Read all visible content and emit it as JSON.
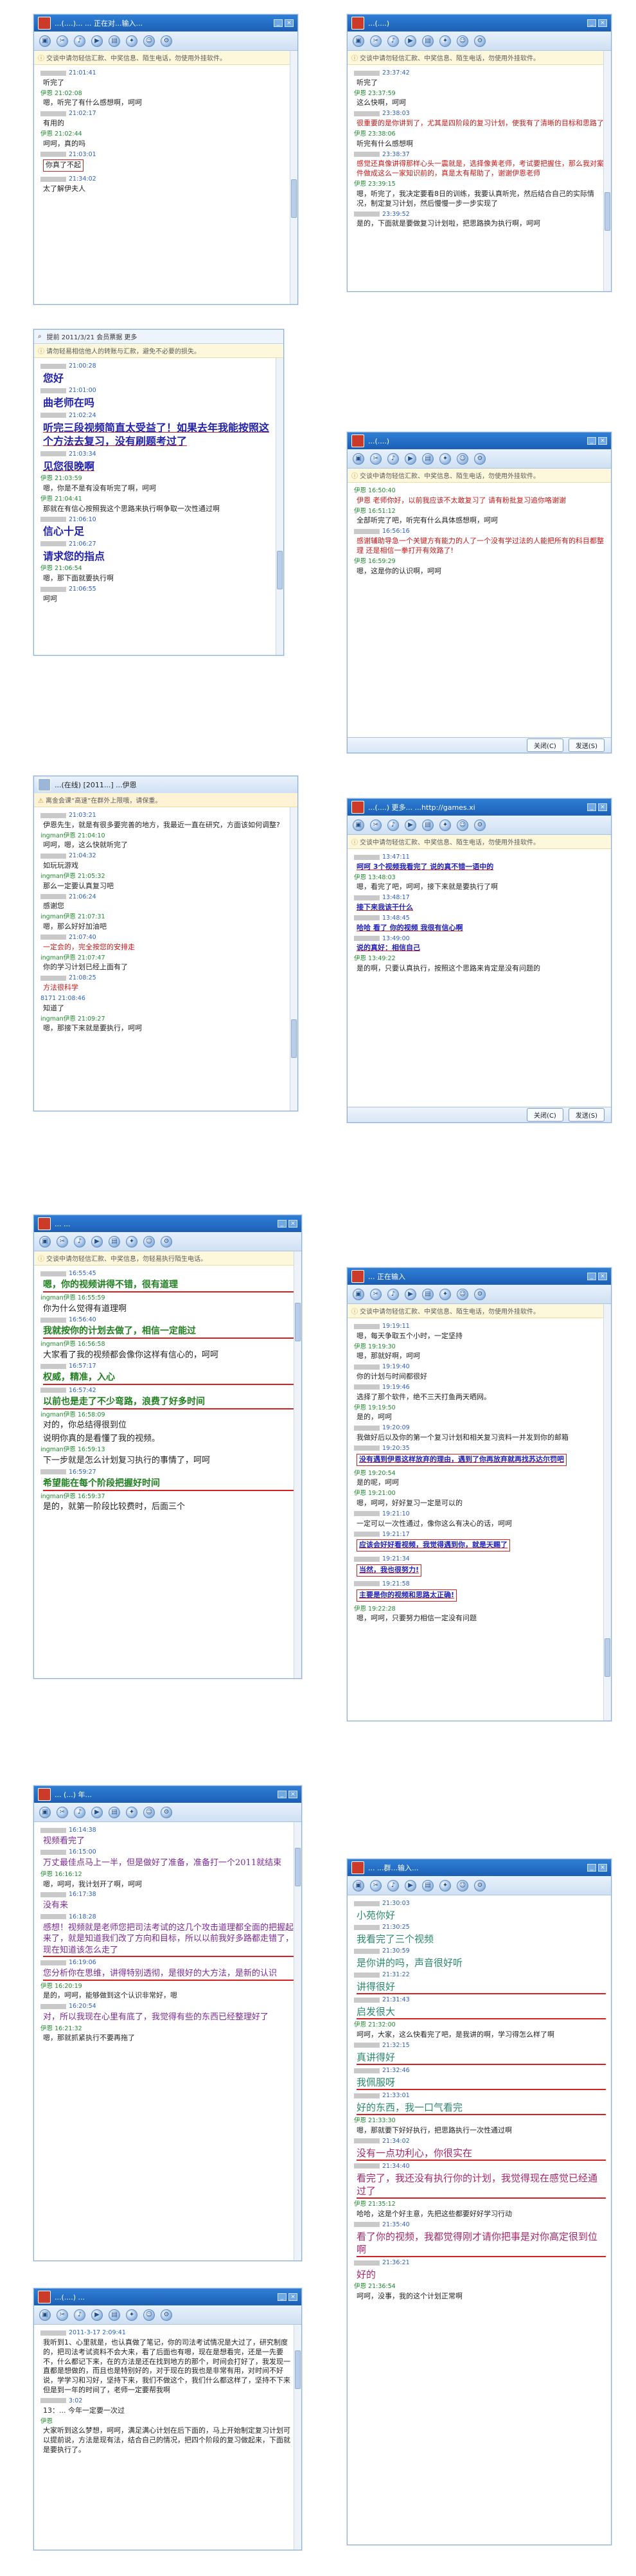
{
  "windows": [
    {
      "title": "...(....)...   ...  正在对...输入...",
      "notice": "交谈中请勿轻信汇款、中奖信息、陌生电话，勿使用外挂软件。",
      "messages": [
        {
          "time": "21:01:41",
          "who": "",
          "text": "听完了",
          "style": ""
        },
        {
          "time": "21:02:08",
          "who": "伊恩",
          "text": "嗯，听完了有什么感想啊，呵呵",
          "style": ""
        },
        {
          "time": "21:02:17",
          "who": "",
          "text": "有用的",
          "style": ""
        },
        {
          "time": "21:02:44",
          "who": "伊恩",
          "text": "呵呵，真的吗",
          "style": ""
        },
        {
          "time": "21:03:01",
          "who": "",
          "text": "你真了不起",
          "style": "box"
        },
        {
          "time": "21:34:02",
          "who": "",
          "text": "太了解伊夫人",
          "style": ""
        }
      ]
    },
    {
      "title": "...(....)",
      "notice": "交谈中请勿轻信汇款、中奖信息、陌生电话，勿使用外挂软件。",
      "messages": [
        {
          "time": "23:37:42",
          "who": "",
          "text": "听完了",
          "style": ""
        },
        {
          "time": "23:37:59",
          "who": "伊恩",
          "text": "这么快啊，呵呵",
          "style": ""
        },
        {
          "time": "23:38:03",
          "who": "",
          "text": "很重要的是你讲到了，尤其是四阶段的复习计划，使我有了清晰的目标和思路了",
          "style": "red"
        },
        {
          "time": "23:38:06",
          "who": "伊恩",
          "text": "听完有什么感想啊",
          "style": ""
        },
        {
          "time": "23:38:37",
          "who": "",
          "text": "感觉还真像讲得那样心头一震就是，选择像黄老师，考试要把握住，那么我对案件做成这么一家知识前的，真是太有帮助了，谢谢伊恩老师",
          "style": "red"
        },
        {
          "time": "23:39:15",
          "who": "伊恩",
          "text": "嗯，听完了，我决定要看8日的训练，我要认真听完，然后结合自己的实际情况，制定复习计划，然后慢慢一步一步实现了",
          "style": ""
        },
        {
          "time": "23:39:52",
          "who": "",
          "text": "是的，下面就是要做复习计划啦，把思路换为执行啊，呵呵",
          "style": ""
        }
      ]
    },
    {
      "title": "提前    2011/3/21        会员票据    更多",
      "notice": "请勿轻易相信他人的转账与汇款，避免不必要的损失。",
      "messages": [
        {
          "time": "21:00:28",
          "who": "伊恩",
          "text": "您好",
          "style": "bigul0"
        },
        {
          "time": "21:01:00",
          "who": "",
          "text": "曲老师在吗",
          "style": "big"
        },
        {
          "time": "21:02:24",
          "who": "",
          "text": "听完三段视频简直太受益了！如果去年我能按照这个方法去复习，没有刷题考过了",
          "style": "bigul"
        },
        {
          "time": "21:03:34",
          "who": "",
          "text": "见您很晚啊",
          "style": "bigul"
        },
        {
          "time": "21:03:59",
          "who": "伊恩",
          "text": "嗯，你是不是有没有听完了啊，呵呵",
          "style": ""
        },
        {
          "time": "21:04:41",
          "who": "伊恩",
          "text": "那就在有信心按照我这个思路来执行啊争取一次性通过啊",
          "style": ""
        },
        {
          "time": "21:06:10",
          "who": "",
          "text": "信心十足",
          "style": "big"
        },
        {
          "time": "21:06:27",
          "who": "",
          "text": "请求您的指点",
          "style": "big"
        },
        {
          "time": "21:06:54",
          "who": "伊恩",
          "text": "嗯，那下面就要执行啊",
          "style": ""
        },
        {
          "time": "21:06:55",
          "who": "",
          "text": "呵呵",
          "style": ""
        }
      ]
    },
    {
      "title": "...(....)",
      "notice": "交谈中请勿轻信汇款、中奖信息、陌生电话，勿使用外挂软件。",
      "messages": [
        {
          "time": "16:50:40",
          "who": "伊恩",
          "text": "伊恩 老师你好，以前我应该不太敢复习了 请有粉批复习追你咯谢谢",
          "style": ""
        },
        {
          "time": "16:51:12",
          "who": "伊恩",
          "text": "全部听完了吧，听完有什么具体感想啊，呵呵",
          "style": ""
        },
        {
          "time": "16:56:16",
          "who": "",
          "text": "感谢辅助导急一个关键方有能力的人了一个没有学过法的人能把所有的科目都整理 还是相信一拳打开有效路了!",
          "style": "red"
        },
        {
          "time": "16:59:29",
          "who": "伊恩",
          "text": "嗯，这是你的认识啊，呵呵",
          "style": ""
        }
      ]
    },
    {
      "title": "...(在线)  [2011...]  ...伊恩",
      "notice": "离金会课“高速”在群外上限哦，请保重。",
      "messages": [
        {
          "time": "21:03:21",
          "who": "",
          "text": "伊恩先生，就是有很多要完善的地方，我最近一直在研究，方面该如何调整?",
          "style": ""
        },
        {
          "time": "21:04:10",
          "who": "ingman伊恩",
          "text": "呵呵，嗯，这么快就听完了",
          "style": ""
        },
        {
          "time": "21:04:32",
          "who": "",
          "text": "如玩玩游戏",
          "style": ""
        },
        {
          "time": "21:05:32",
          "who": "ingman伊恩",
          "text": "那么一定要认真复习吧",
          "style": ""
        },
        {
          "time": "21:06:24",
          "who": "",
          "text": "感谢您",
          "style": ""
        },
        {
          "time": "21:07:31",
          "who": "ingman伊恩",
          "text": "嗯，那么好好加油吧",
          "style": ""
        },
        {
          "time": "21:07:40",
          "who": "",
          "text": "一定会的，完全按您的安排走",
          "style": "red"
        },
        {
          "time": "21:07:47",
          "who": "ingman伊恩",
          "text": "你的学习计划已经上面有了",
          "style": ""
        },
        {
          "time": "21:08:25",
          "who": "",
          "text": "方法很科学",
          "style": "red"
        },
        {
          "time": "21:08:46",
          "who": "8171",
          "text": "知道了",
          "style": ""
        },
        {
          "time": "21:09:27",
          "who": "ingman伊恩",
          "text": "嗯，那接下来就是要执行，呵呵",
          "style": ""
        }
      ]
    },
    {
      "title": "...(....)  更多...  ...http://games.xi",
      "notice": "交谈中请勿轻信汇款、中奖信息、陌生电话，勿使用外挂软件。",
      "messages": [
        {
          "time": "13:47:11",
          "who": "",
          "text": "呵呵  3个视频我看完了 说的真不错一语中的",
          "style": "hl"
        },
        {
          "time": "13:48:03",
          "who": "伊恩",
          "text": "嗯，看完了吧，呵呵，接下来就是要执行了啊",
          "style": ""
        },
        {
          "time": "13:48:17",
          "who": "",
          "text": "接下来我该干什么",
          "style": "hl"
        },
        {
          "time": "13:48:45",
          "who": "",
          "text": "哈哈  看了 你的视频 我很有信心啊",
          "style": "hl"
        },
        {
          "time": "13:49:00",
          "who": "",
          "text": "说的真好：相信自己",
          "style": "hl"
        },
        {
          "time": "13:49:22",
          "who": "伊恩",
          "text": "是的啊，只要认真执行，按照这个思路来肯定是没有问题的",
          "style": ""
        }
      ]
    },
    {
      "title": "... ...",
      "notice": "交谈中请勿轻信汇款、中奖信息，勿轻易执行陌生电话。",
      "messages": [
        {
          "time": "16:55:45",
          "who": "",
          "text": "嗯，你的视频讲得不错，很有道理",
          "style": "hlg"
        },
        {
          "time": "16:55:59",
          "who": "ingman伊恩",
          "text": "你为什么觉得有道理啊",
          "style": "green0"
        },
        {
          "time": "16:56:40",
          "who": "",
          "text": "我就按你的计划去做了，相信一定能过",
          "style": "hlg"
        },
        {
          "time": "16:56:58",
          "who": "ingman伊恩",
          "text": "大家看了我的视频都会像你这样有信心的，呵呵",
          "style": "green0"
        },
        {
          "time": "16:57:17",
          "who": "",
          "text": "权威，精准，入心",
          "style": "hlg"
        },
        {
          "time": "16:57:42",
          "who": "",
          "text": "以前也是走了不少弯路，浪费了好多时间",
          "style": "hlg"
        },
        {
          "time": "16:58:09",
          "who": "ingman伊恩",
          "text": "对的，你总结得很到位",
          "style": "green0"
        },
        {
          "time": "16:58:40",
          "who": "",
          "text": "说明你真的是看懂了我的视频。",
          "style": "green0"
        },
        {
          "time": "16:59:13",
          "who": "ingman伊恩",
          "text": "下一步就是怎么计划复习执行的事情了，呵呵",
          "style": "green0"
        },
        {
          "time": "16:59:27",
          "who": "",
          "text": "希望能在每个阶段把握好时间",
          "style": "hlg"
        },
        {
          "time": "16:59:37",
          "who": "ingman伊恩",
          "text": "是的，就第一阶段比较费时，后面三个",
          "style": "green0"
        }
      ]
    },
    {
      "title": "...  正在输入",
      "notice": "交谈中请勿轻信汇款、中奖信息、陌生电话，勿使用外挂软件。",
      "messages": [
        {
          "time": "19:19:11",
          "who": "",
          "text": "嗯，每天争取五个小时，一定坚持",
          "style": ""
        },
        {
          "time": "19:19:30",
          "who": "伊恩",
          "text": "嗯，那就好啊，呵呵",
          "style": ""
        },
        {
          "time": "19:19:40",
          "who": "",
          "text": "你的计划与时间都很好",
          "style": ""
        },
        {
          "time": "19:19:46",
          "who": "",
          "text": "选择了那个软件，绝不三天打鱼两天晒网。",
          "style": ""
        },
        {
          "time": "19:19:50",
          "who": "伊恩",
          "text": "是的，呵呵",
          "style": ""
        },
        {
          "time": "19:20:09",
          "who": "",
          "text": "我做好后以及你的第一个复习计划和相关复习资料一并发到你的邮箱",
          "style": ""
        },
        {
          "time": "19:20:35",
          "who": "",
          "text": "没有遇到伊恩这样放弃的理由，遇到了你再放弃就再找苏达尔罚吧",
          "style": "blueul"
        },
        {
          "time": "19:20:54",
          "who": "伊恩",
          "text": "是的呢，呵呵",
          "style": ""
        },
        {
          "time": "19:21:00",
          "who": "伊恩",
          "text": "嗯，呵呵，好好复习一定是可以的",
          "style": ""
        },
        {
          "time": "19:21:10",
          "who": "",
          "text": "一定可以一次性通过，像你这么有决心的话，呵呵",
          "style": ""
        },
        {
          "time": "19:21:17",
          "who": "",
          "text": "应该会好好看视频，我觉得遇到你，就是天赐了",
          "style": "blueul"
        },
        {
          "time": "19:21:34",
          "who": "",
          "text": "当然，我也很努力!",
          "style": "blueul"
        },
        {
          "time": "19:21:58",
          "who": "",
          "text": "主要是你的视频和思路太正确!",
          "style": "blueul"
        },
        {
          "time": "19:22:28",
          "who": "伊恩",
          "text": "嗯，呵呵，只要努力相信一定没有问题",
          "style": ""
        }
      ]
    },
    {
      "title": "... (...) 年...",
      "notice": "",
      "messages": [
        {
          "time": "16:14:38",
          "who": "",
          "text": "视频看完了",
          "style": "purple"
        },
        {
          "time": "16:15:00",
          "who": "",
          "text": "万丈最佳点马上一半，但是做好了准备，准备打一个2011就结束",
          "style": "purple"
        },
        {
          "time": "16:16:12",
          "who": "伊恩",
          "text": "嗯，呵呵，我计划开了啊，呵呵",
          "style": ""
        },
        {
          "time": "16:17:38",
          "who": "",
          "text": "没有来",
          "style": "purple"
        },
        {
          "time": "16:18:28",
          "who": "",
          "text": "感想！视频就是老师您把司法考试的这几个攻击道理都全面的把握起来了，就是知道我们改了方向和目标，所以以前我好多路都走错了，现在知道该怎么走了",
          "style": "purple"
        },
        {
          "time": "16:19:06",
          "who": "",
          "text": "您分析你在思维，讲得特别透彻，是很好的大方法，是新的认识",
          "style": "purple"
        },
        {
          "time": "16:20:19",
          "who": "伊恩",
          "text": "是的，呵呵，能够做到这个认识非常好，嗯",
          "style": ""
        },
        {
          "time": "16:20:54",
          "who": "",
          "text": "对，所以我现在心里有底了，我觉得有些的东西已经整理好了",
          "style": "purple"
        },
        {
          "time": "16:21:32",
          "who": "伊恩",
          "text": "嗯，那就抓紧执行不要再拖了",
          "style": ""
        }
      ]
    },
    {
      "title": "...  ...群...输入...",
      "notice": "",
      "messages": [
        {
          "time": "21:30:03",
          "who": "",
          "text": "小苑你好",
          "style": "teal"
        },
        {
          "time": "21:30:25",
          "who": "",
          "text": "我看完了三个视频",
          "style": "teal"
        },
        {
          "time": "21:30:59",
          "who": "",
          "text": "是你讲的吗，声音很好听",
          "style": "teal"
        },
        {
          "time": "21:31:22",
          "who": "",
          "text": "讲得很好",
          "style": "teal"
        },
        {
          "time": "21:31:43",
          "who": "",
          "text": "启发很大",
          "style": "teal"
        },
        {
          "time": "21:32:00",
          "who": "伊恩",
          "text": "呵呵，大家，这么快看完了吧，是我讲的啊，学习得怎么样了啊",
          "style": ""
        },
        {
          "time": "21:32:15",
          "who": "",
          "text": "真讲得好",
          "style": "teal"
        },
        {
          "time": "21:32:46",
          "who": "",
          "text": "我佩服呀",
          "style": "teal"
        },
        {
          "time": "21:33:01",
          "who": "",
          "text": "好的东西，我一口气看完",
          "style": "teal"
        },
        {
          "time": "21:33:30",
          "who": "伊恩",
          "text": "嗯，那就要下好好执行，把思路执行一次性通过啊",
          "style": ""
        },
        {
          "time": "21:34:02",
          "who": "",
          "text": "没有一点功利心，你很实在",
          "style": "wine"
        },
        {
          "time": "21:34:40",
          "who": "",
          "text": "看完了，我还没有执行你的计划，我觉得现在感觉已经通过了",
          "style": "wine"
        },
        {
          "time": "21:35:12",
          "who": "伊恩",
          "text": "哈哈，这是个好主意，先把这些都要好好学习行动",
          "style": ""
        },
        {
          "time": "21:35:40",
          "who": "",
          "text": "看了你的视频，我都觉得刚才请你把事是对你高定很到位啊",
          "style": "wine"
        },
        {
          "time": "21:36:21",
          "who": "",
          "text": "好的",
          "style": "wine"
        },
        {
          "time": "21:36:54",
          "who": "伊恩",
          "text": "呵呵，没事，我的这个计划正常啊",
          "style": ""
        }
      ]
    },
    {
      "title": "...(....)  ...",
      "notice": "",
      "messages": [
        {
          "time": "2011-3-17 2:09:41",
          "who": "",
          "text": "我听到1、心里就是，也认真做了笔记，你的司法考试情况是大过了，研究制度的，把司法考试资料不会大来，看了后面也有嗯，现在是想看完，还是一先要不，什么都记下来，在的方法是还在找到地方的那个，时间会打好了，我发现一直都是想做的，而且也是特别好的，对于现在的我也是非常有用，对时间不好说，学学习和习好，坚持下来，我们不做这个，我们什么都这样了，坚持不下来但是到一年的时间了，老师一定要帮我啊",
          "style": ""
        },
        {
          "time": "3:02",
          "who": "",
          "text": "13：... 今年一定要一次过",
          "style": ""
        },
        {
          "time": "",
          "who": "伊恩",
          "text": "大家听到这么梦想，呵呵，满足满心计划在后下面的，马上开始制定复习计划可以提前说，方法是现有法，结合自己的情况，把四个阶段的复习做起来，下面就是要执行了。",
          "style": ""
        }
      ]
    }
  ],
  "toolbar_icons": [
    "photo-icon",
    "scissors-icon",
    "voice-icon",
    "video-icon",
    "file-icon",
    "app-icon",
    "emoji-icon",
    "gear-icon"
  ],
  "bottom_buttons": {
    "close": "关闭(C)",
    "send": "发送(S)"
  }
}
